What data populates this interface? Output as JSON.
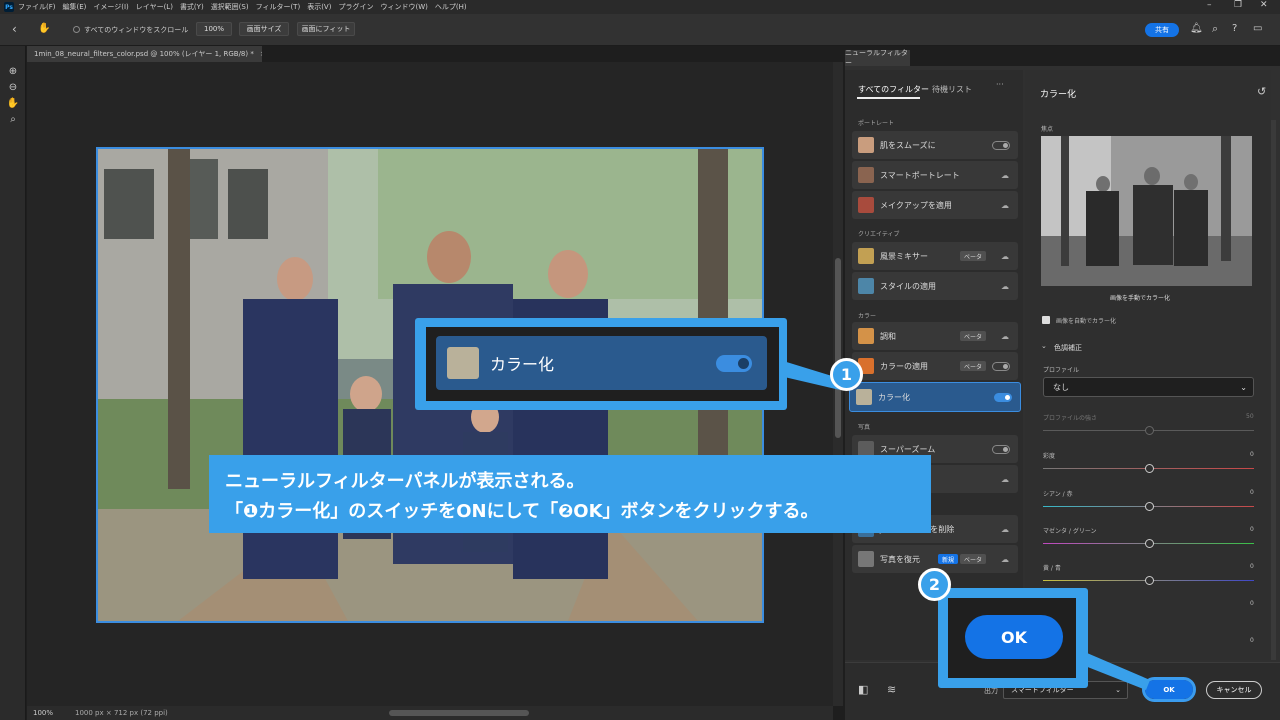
{
  "menubar": {
    "app_icon": "Ps",
    "items": [
      "ファイル(F)",
      "編集(E)",
      "イメージ(I)",
      "レイヤー(L)",
      "書式(Y)",
      "選択範囲(S)",
      "フィルター(T)",
      "表示(V)",
      "プラグイン",
      "ウィンドウ(W)",
      "ヘルプ(H)"
    ]
  },
  "options": {
    "scroll_all": "すべてのウィンドウをスクロール",
    "zoom": "100%",
    "fit_screen": "画面サイズ",
    "fill_screen": "画面にフィット",
    "share": "共有"
  },
  "document": {
    "tab_title": "1min_08_neural_filters_color.psd @ 100% (レイヤー 1, RGB/8) *",
    "zoom": "100%",
    "dimensions": "1000 px × 712 px (72 ppi)"
  },
  "panel": {
    "tab": "ニューラルフィルター",
    "tabs": {
      "all": "すべてのフィルター",
      "waitlist": "待機リスト",
      "more": "···"
    },
    "categories": {
      "portrait": "ポートレート",
      "creative": "クリエイティブ",
      "color": "カラー",
      "photo": "写真"
    },
    "filters": {
      "skin": "肌をスムーズに",
      "smart_portrait": "スマートポートレート",
      "makeup": "メイクアップを適用",
      "landscape": "風景ミキサー",
      "style": "スタイルの適用",
      "harmonize": "調和",
      "color_transfer": "カラーの適用",
      "colorize": "カラー化",
      "superzoom": "スーパーズーム",
      "jpeg": "JPEGのノイズを削除",
      "restore": "写真を復元"
    },
    "badges": {
      "beta": "ベータ",
      "new": "新規"
    }
  },
  "settings": {
    "title": "カラー化",
    "focus_label": "焦点",
    "manual_label": "画像を手動でカラー化",
    "auto_label": "画像を自動でカラー化",
    "color_adjust": "色調補正",
    "profile_label": "プロファイル",
    "profile_value": "なし",
    "profile_strength": "プロファイルの強さ",
    "profile_strength_value": "50",
    "saturation": "彩度",
    "cyan_red": "シアン / 赤",
    "magenta_green": "マゼンタ / グリーン",
    "yellow_blue": "黄 / 青",
    "zero": "0"
  },
  "bottom": {
    "output_label": "出力",
    "output_value": "スマートフィルター",
    "ok": "OK",
    "cancel": "キャンセル"
  },
  "callout": {
    "badge1": "1",
    "badge2": "2",
    "big_name": "カラー化",
    "big_ok": "OK",
    "line1": "ニューラルフィルターパネルが表示される。",
    "line2": "「❶カラー化」のスイッチをONにして「❷OK」ボタンをクリックする。"
  },
  "colors": {
    "accent": "#39a0ea",
    "brand": "#1473e6"
  }
}
